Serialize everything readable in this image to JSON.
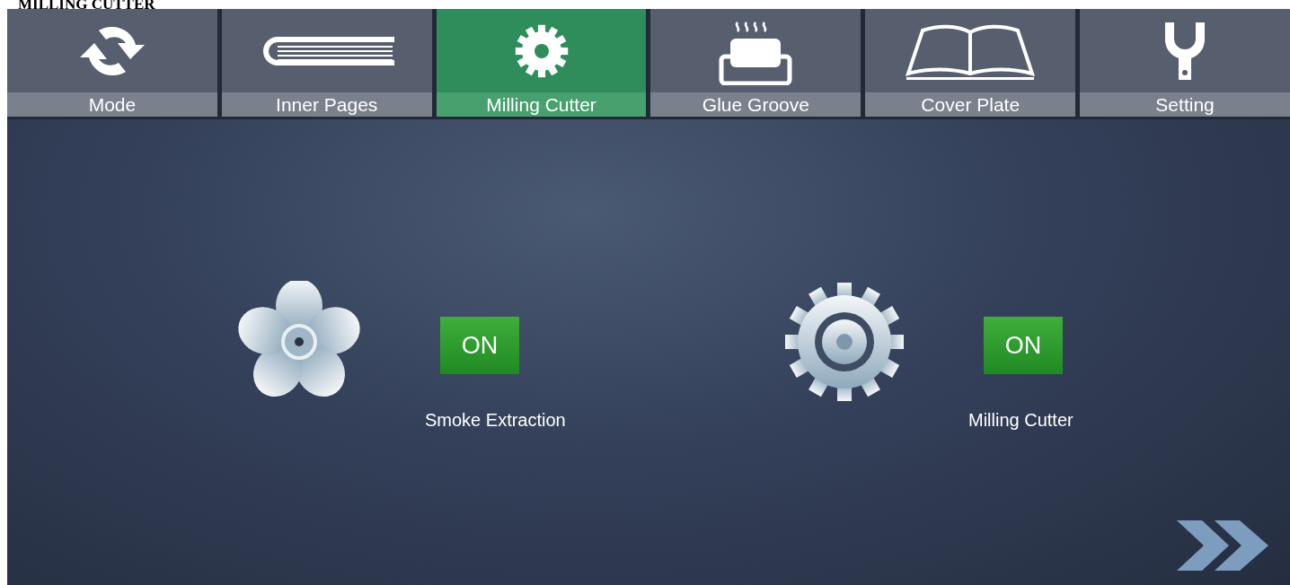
{
  "caption": "MILLING CUTTER",
  "tabs": [
    {
      "label": "Mode",
      "kind": "cycle",
      "selected": false
    },
    {
      "label": "Inner Pages",
      "kind": "book",
      "selected": false
    },
    {
      "label": "Milling Cutter",
      "kind": "gear",
      "selected": true
    },
    {
      "label": "Glue Groove",
      "kind": "glue",
      "selected": false
    },
    {
      "label": "Cover Plate",
      "kind": "openbook",
      "selected": false
    },
    {
      "label": "Setting",
      "kind": "wrench",
      "selected": false
    }
  ],
  "controls": [
    {
      "kind": "fan",
      "button": "ON",
      "on": true,
      "label": "Smoke Extraction"
    },
    {
      "kind": "gear",
      "button": "ON",
      "on": true,
      "label": "Milling Cutter"
    }
  ]
}
